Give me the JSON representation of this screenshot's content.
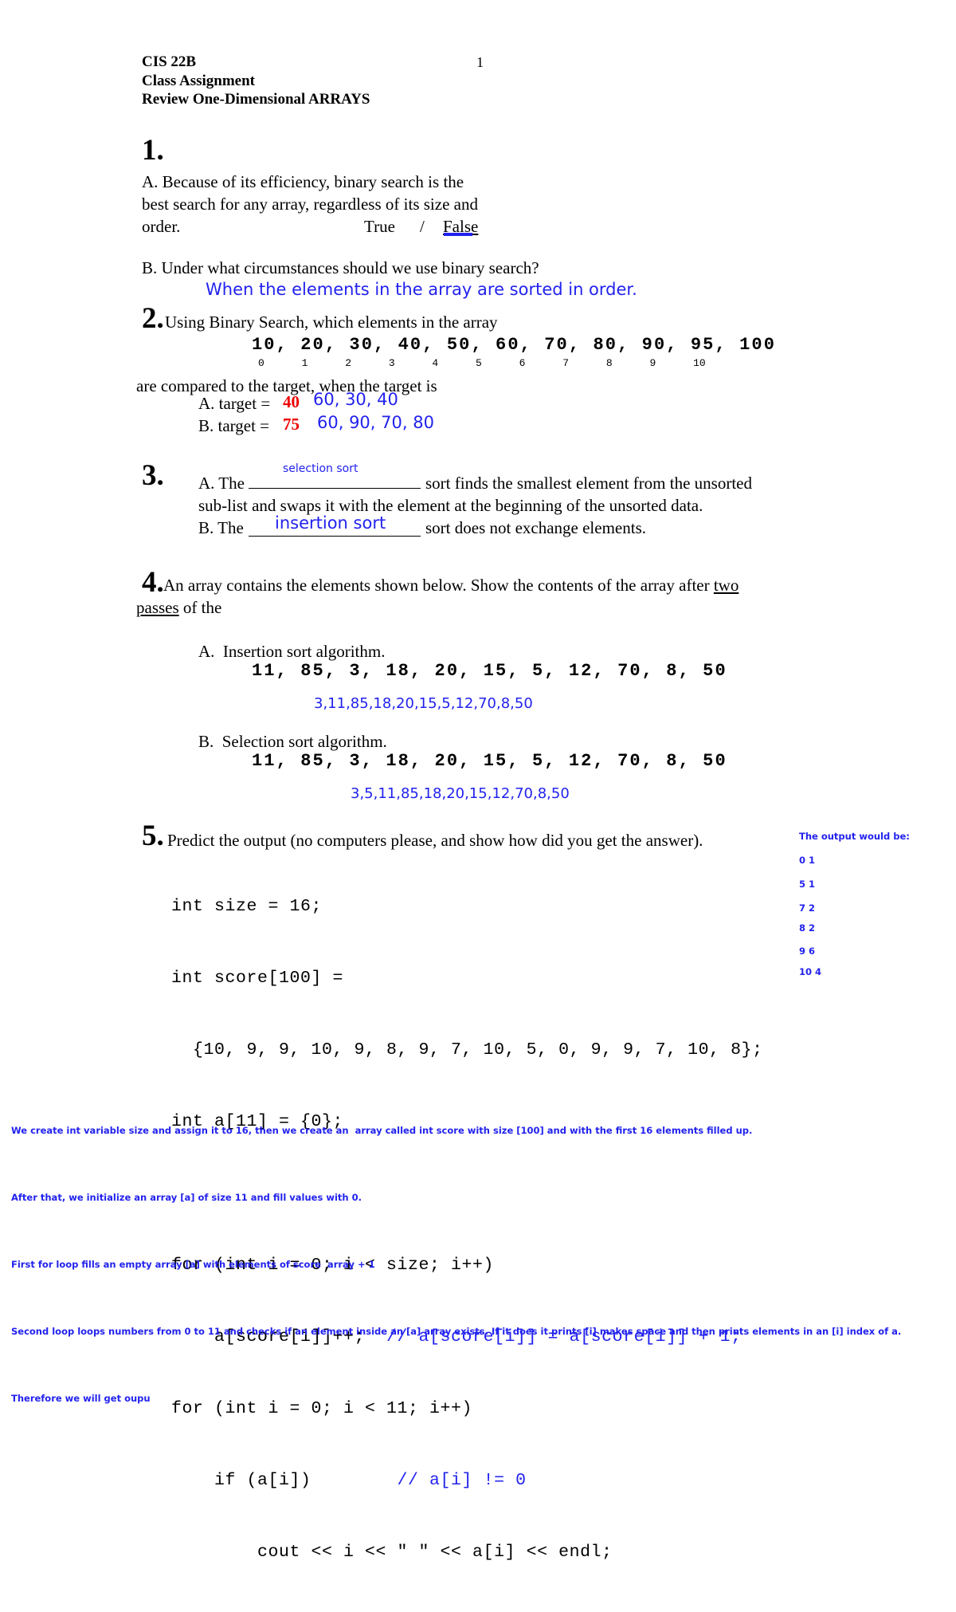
{
  "header": {
    "course": "CIS 22B",
    "doc_type": "Class Assignment",
    "subtitle": "Review One-Dimensional ARRAYS",
    "page_number": "1"
  },
  "q1": {
    "number": "1.",
    "part_a_line1": "A. Because of its efficiency, binary search is the",
    "part_a_line2": "best search for any array, regardless of its size and",
    "part_a_line3": "order.",
    "choice_true": "True",
    "choice_sep": "/",
    "choice_false": "False",
    "part_b_question": "B. Under what circumstances should we use binary search?",
    "part_b_answer": "When the elements in the array are sorted in order."
  },
  "q2": {
    "number": "2.",
    "prompt_line1": "Using Binary Search, which elements in the array",
    "array_values": "10, 20, 30, 40, 50, 60, 70, 80, 90, 95, 100",
    "array_indices": "0      1      2      3      4      5      6      7      8      9      10",
    "prompt_line2": "are compared to the target, when the target is",
    "part_a_label": "A. target =",
    "part_a_target": "40",
    "part_a_answer": "60, 30, 40",
    "part_b_label": "B. target =",
    "part_b_target": "75",
    "part_b_answer": "60, 90, 70, 80"
  },
  "q3": {
    "number": "3.",
    "part_a_pre": "A. The",
    "part_a_blank_answer": "selection sort",
    "part_a_post": "sort finds the smallest element from the unsorted",
    "part_a_line2": "sub-list and swaps it with the element at the beginning of the unsorted data.",
    "part_b_pre": "B. The",
    "part_b_blank_answer": "insertion sort",
    "part_b_post": "sort does not exchange elements."
  },
  "q4": {
    "number": "4.",
    "prompt_line1_pre": "An array contains the elements shown below. Show the contents of the array after ",
    "prompt_line1_ul": "two",
    "prompt_line2_ul": "passes",
    "prompt_line2_post": " of the",
    "part_a_label": "A.  Insertion sort algorithm.",
    "part_a_array": "11, 85, 3, 18, 20, 15, 5, 12, 70, 8, 50",
    "part_a_answer": "3,11,85,18,20,15,5,12,70,8,50",
    "part_b_label": "B.  Selection sort algorithm.",
    "part_b_array": "11, 85, 3, 18, 20, 15, 5, 12, 70, 8, 50",
    "part_b_answer": "3,5,11,85,18,20,15,12,70,8,50"
  },
  "q5": {
    "number": "5.",
    "prompt": "Predict the output (no computers please, and show how did you get the answer).",
    "code": {
      "line1": "int size = 16;",
      "line2": "int score[100] =",
      "line3": "  {10, 9, 9, 10, 9, 8, 9, 7, 10, 5, 0, 9, 9, 7, 10, 8};",
      "line4": "int a[11] = {0};",
      "line5": "",
      "line6": "for (int i = 0; i < size; i++)",
      "line7_code": "    a[score[i]]++;  ",
      "line7_comment": "// a[score[i]] = a[score[i]] + 1;",
      "line8": "for (int i = 0; i < 11; i++)",
      "line9_code": "    if (a[i])        ",
      "line9_comment": "// a[i] != 0",
      "line10": "        cout << i << \" \" << a[i] << endl;"
    },
    "output": {
      "title": "The output would be:",
      "lines": [
        "0 1",
        "5 1",
        "7 2",
        "8 2",
        "9 6",
        "10 4"
      ]
    },
    "explanation": [
      "We create int variable size and assign it to 16, then we create an  array called int score with size [100] and with the first 16 elements filled up.",
      "After that, we initialize an array [a] of size 11 and fill values with 0.",
      "First for loop fills an empty array [a] with elements of score  array + 1",
      "Second loop loops numbers from 0 to 11 and checks if an element inside an [a] array exists. If it does it prints [i] makes space and then prints elements in an [i] index of a.",
      "Therefore we will get oupu"
    ]
  },
  "colors": {
    "ink_blue": "#2222ee",
    "ink_red": "#ee0000",
    "text_black": "#000000"
  }
}
